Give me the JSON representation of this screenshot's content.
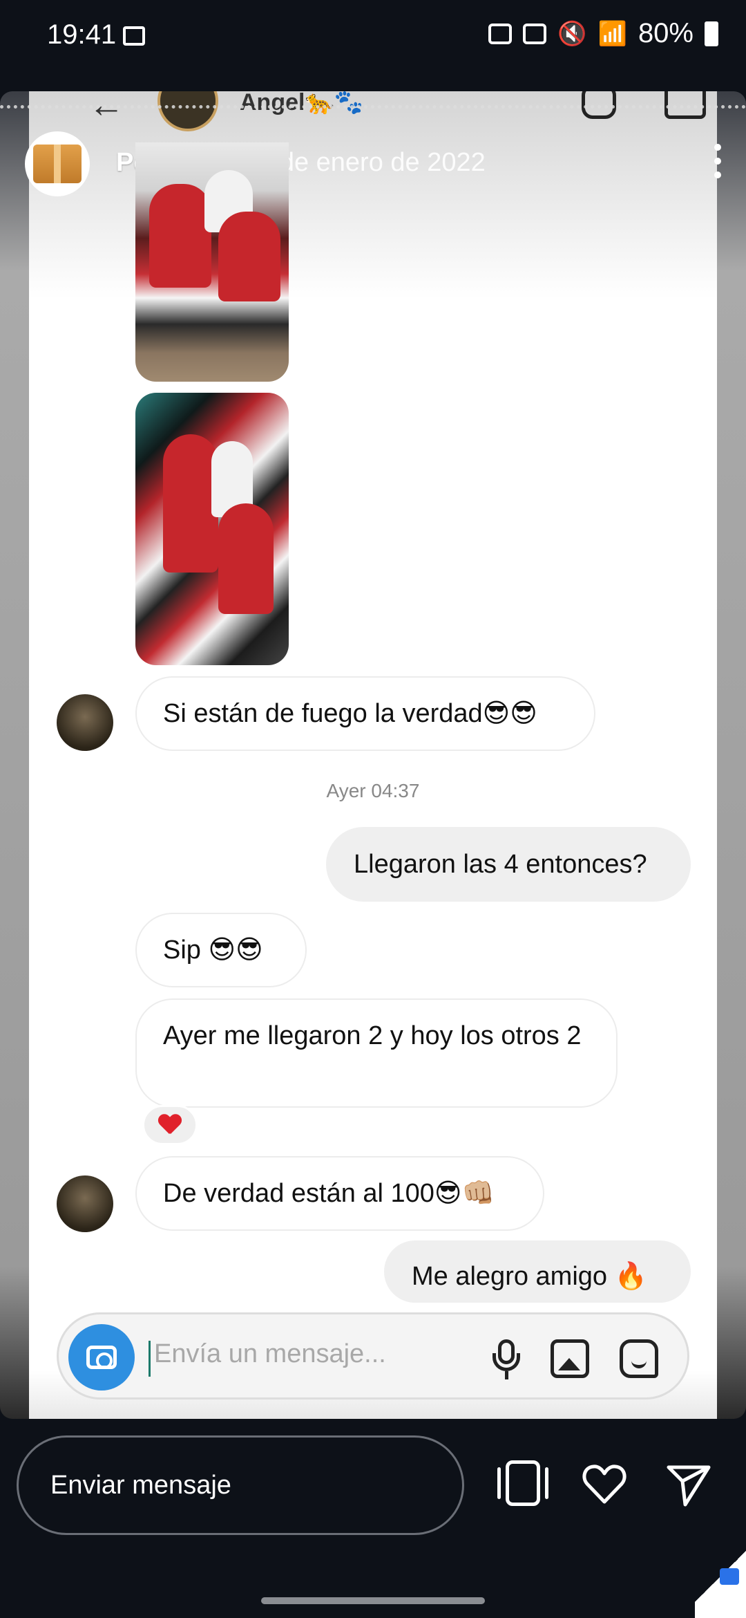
{
  "status_bar": {
    "time": "19:41",
    "battery": "80%",
    "icons": [
      "gallery-icon",
      "upload-icon",
      "nfc-icon",
      "mute-icon",
      "wifi-icon",
      "signal-icon",
      "battery-icon"
    ]
  },
  "chat_header_behind": {
    "name": "Angel🐆🐾"
  },
  "story": {
    "username": "Pedidos",
    "date": "16 de enero de 2022"
  },
  "messages": [
    {
      "side": "in",
      "type": "image",
      "description_icon": "sneakers-photo"
    },
    {
      "side": "in",
      "type": "image",
      "description_icon": "sneakers-photo"
    },
    {
      "side": "in",
      "text": "Si están de fuego la verdad😎😎"
    },
    {
      "type": "timestamp",
      "text": "Ayer 04:37"
    },
    {
      "side": "out",
      "text": "Llegaron las 4 entonces?"
    },
    {
      "side": "in",
      "text": "Sip 😎😎"
    },
    {
      "side": "in",
      "text": "Ayer me llegaron 2 y hoy los otros 2",
      "reaction": "❤️"
    },
    {
      "side": "in",
      "text": "De verdad están al 100😎👊🏼"
    },
    {
      "side": "out",
      "text": "Me alegro amigo 🔥"
    }
  ],
  "composer": {
    "placeholder": "Envía un mensaje..."
  },
  "reply_bar": {
    "label": "Enviar mensaje"
  },
  "colors": {
    "accent_blue": "#2e8fe0",
    "background": "#0d1118"
  }
}
